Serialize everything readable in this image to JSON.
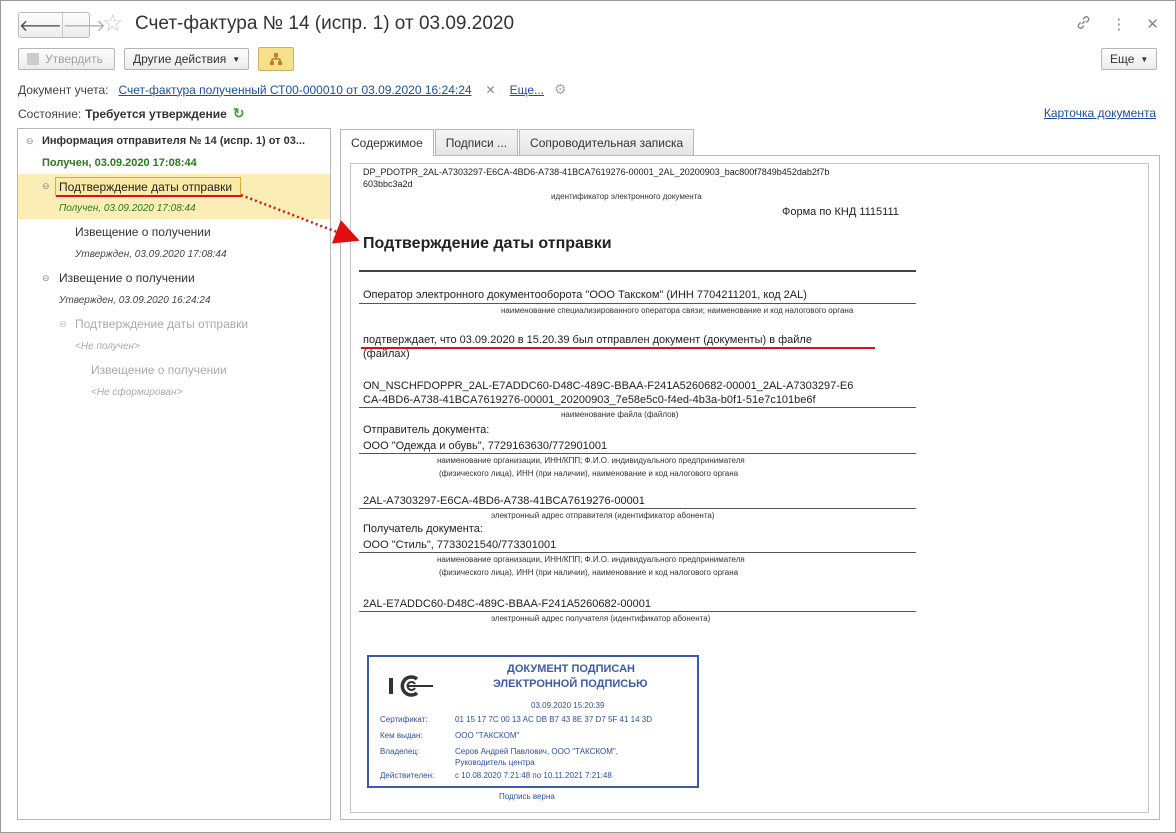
{
  "window": {
    "title": "Счет-фактура № 14 (испр. 1) от 03.09.2020"
  },
  "toolbar": {
    "approve_label": "Утвердить",
    "other_actions_label": "Другие действия",
    "more_label": "Еще"
  },
  "document_row": {
    "label": "Документ учета:",
    "link": "Счет-фактура полученный СТ00-000010 от 03.09.2020 16:24:24",
    "more_link": "Еще..."
  },
  "state_row": {
    "label": "Состояние:",
    "value": "Требуется утверждение"
  },
  "card_link": "Карточка документа",
  "tree": {
    "root_label": "Информация отправителя № 14 (испр. 1) от 03...",
    "root_status": "Получен, 03.09.2020 17:08:44",
    "items": [
      {
        "label": "Подтверждение даты отправки",
        "status": "Получен, 03.09.2020 17:08:44"
      },
      {
        "label": "Извещение о получении",
        "status": "Утвержден, 03.09.2020 17:08:44"
      },
      {
        "label": "Извещение о получении",
        "status": "Утвержден, 03.09.2020 16:24:24"
      },
      {
        "label": "Подтверждение даты отправки",
        "status": "<Не получен>"
      },
      {
        "label": "Извещение о получении",
        "status": "<Не сформирован>"
      }
    ]
  },
  "tabs": [
    "Содержимое",
    "Подписи ...",
    "Сопроводительная записка"
  ],
  "document": {
    "file_id_line1": "DP_PDOTPR_2AL-A7303297-E6CA-4BD6-A738-41BCA7619276-00001_2AL_20200903_bac800f7849b452dab2f7b",
    "file_id_line2": "603bbc3a2d",
    "file_id_caption": "идентификатор электронного документа",
    "form_code": "Форма по КНД 1115111",
    "heading": "Подтверждение даты отправки",
    "operator": "Оператор электронного документооборота \"ООО Такском\" (ИНН 7704211201, код 2AL)",
    "operator_caption": "наименование специализированного оператора связи; наименование и код налогового органа",
    "confirm_line1": "подтверждает, что 03.09.2020 в 15.20.39 был отправлен документ  (документы) в файле",
    "confirm_line2": "(файлах)",
    "file_name_line1": "ON_NSCHFDOPPR_2AL-E7ADDC60-D48C-489C-BBAA-F241A5260682-00001_2AL-A7303297-E6",
    "file_name_line2": "CA-4BD6-A738-41BCA7619276-00001_20200903_7e58e5c0-f4ed-4b3a-b0f1-51e7c101be6f",
    "file_name_caption": "наименование файла (файлов)",
    "sender_label": "Отправитель документа:",
    "sender_value": "ООО \"Одежда и обувь\", 7729163630/772901001",
    "org_caption_1": "наименование организации, ИНН/КПП; Ф.И.О. индивидуального предпринимателя",
    "org_caption_2": "(физического лица), ИНН (при наличии), наименование и код налогового органа",
    "sender_address": "2AL-A7303297-E6CA-4BD6-A738-41BCA7619276-00001",
    "sender_address_caption": "электронный адрес отправителя (идентификатор абонента)",
    "receiver_label": "Получатель документа:",
    "receiver_value": "ООО \"Стиль\", 7733021540/773301001",
    "receiver_address": "2AL-E7ADDC60-D48C-489C-BBAA-F241A5260682-00001",
    "receiver_address_caption": "электронный адрес получателя (идентификатор абонента)"
  },
  "stamp": {
    "logo": "1С",
    "title_line1": "ДОКУМЕНТ ПОДПИСАН",
    "title_line2": "ЭЛЕКТРОННОЙ ПОДПИСЬЮ",
    "datetime": "03.09.2020 15:20:39",
    "cert_label": "Сертификат:",
    "cert_value": "01 15 17 7C 00 13 AC DB B7 43 8E 37 D7 5F 41 14 3D",
    "issuer_label": "Кем выдан:",
    "issuer_value": "ООО \"ТАКСКОМ\"",
    "owner_label": "Владелец:",
    "owner_value_1": "Серов Андрей Павлович, ООО \"ТАКСКОМ\",",
    "owner_value_2": "Руководитель центра",
    "valid_label": "Действителен:",
    "valid_value": "с 10.08.2020 7:21:48 по 10.11.2021 7:21:48",
    "signature_status": "Подпись верна"
  },
  "colors": {
    "link": "#1a4f9e",
    "received_green": "#2a7a1f",
    "highlight": "#fbedb6",
    "annotation_red": "#e01010",
    "stamp_blue": "#3b5ba6"
  }
}
